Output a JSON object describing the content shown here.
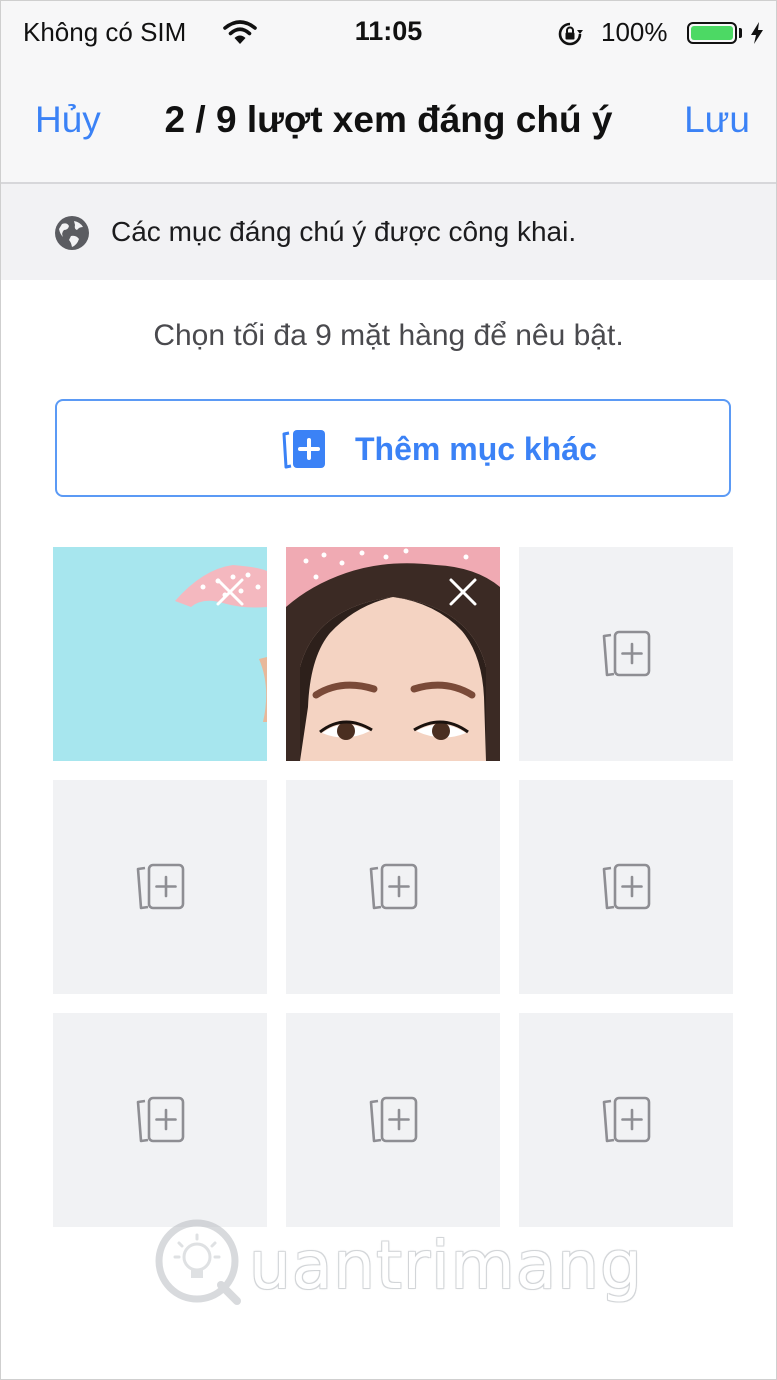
{
  "status_bar": {
    "carrier": "Không có SIM",
    "time": "11:05",
    "battery_percent": "100%",
    "battery_level": 1.0,
    "battery_color": "#4cd964"
  },
  "nav": {
    "cancel_label": "Hủy",
    "title": "2 / 9 lượt xem đáng chú ý",
    "save_label": "Lưu"
  },
  "notice": {
    "icon": "globe-icon",
    "text": "Các mục đáng chú ý được công khai."
  },
  "instruction": "Chọn tối đa 9 mặt hàng để nêu bật.",
  "add_button": {
    "icon": "add-media-icon",
    "label": "Thêm mục khác"
  },
  "grid": {
    "selected_count": 2,
    "max": 9,
    "tiles": [
      {
        "state": "photo",
        "photo": "turquoise-background-pink-bow"
      },
      {
        "state": "photo",
        "photo": "face-closeup-pink-bow"
      },
      {
        "state": "empty"
      },
      {
        "state": "empty"
      },
      {
        "state": "empty"
      },
      {
        "state": "empty"
      },
      {
        "state": "empty"
      },
      {
        "state": "empty"
      },
      {
        "state": "empty"
      }
    ]
  },
  "watermark": {
    "text": "uantrimang"
  },
  "colors": {
    "accent": "#3b82f6",
    "bar_bg": "#f7f7f8",
    "tile_bg": "#f1f2f4"
  }
}
